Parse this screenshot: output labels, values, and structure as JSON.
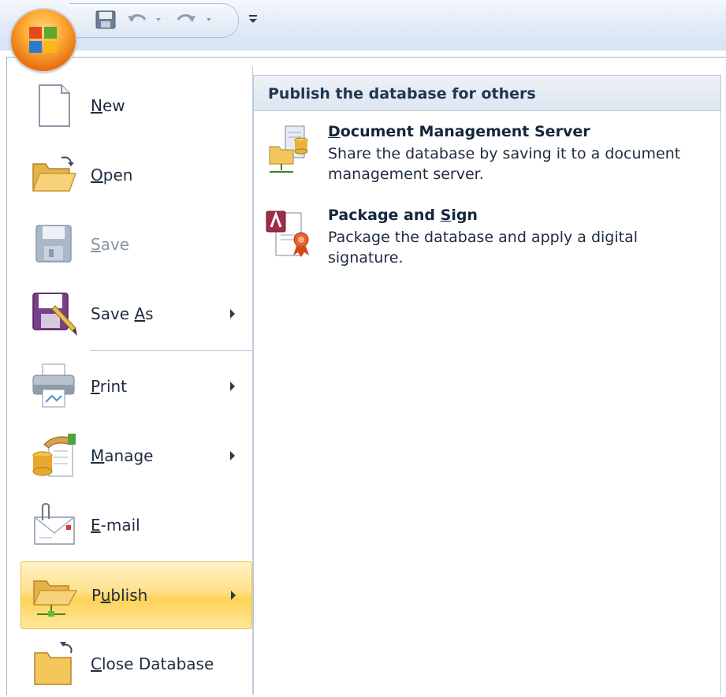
{
  "quick_access": {
    "icons": [
      "save-icon",
      "undo-icon",
      "redo-icon",
      "customize-dropdown-icon"
    ]
  },
  "menu": {
    "items": [
      {
        "label": "New",
        "hotkey_index": 0,
        "icon": "new-document-icon",
        "submenu": false,
        "enabled": true
      },
      {
        "label": "Open",
        "hotkey_index": 0,
        "icon": "open-folder-icon",
        "submenu": false,
        "enabled": true
      },
      {
        "label": "Save",
        "hotkey_index": 0,
        "icon": "save-disk-icon",
        "submenu": false,
        "enabled": false
      },
      {
        "label": "Save As",
        "hotkey_index": 5,
        "icon": "save-as-icon",
        "submenu": true,
        "enabled": true
      },
      {
        "label": "Print",
        "hotkey_index": 0,
        "icon": "printer-icon",
        "submenu": true,
        "enabled": true
      },
      {
        "label": "Manage",
        "hotkey_index": 0,
        "icon": "manage-database-icon",
        "submenu": true,
        "enabled": true
      },
      {
        "label": "E-mail",
        "hotkey_index": 0,
        "icon": "email-icon",
        "submenu": false,
        "enabled": true
      },
      {
        "label": "Publish",
        "hotkey_index": 1,
        "icon": "publish-folder-icon",
        "submenu": true,
        "enabled": true,
        "selected": true
      },
      {
        "label": "Close Database",
        "hotkey_index": 0,
        "icon": "close-folder-icon",
        "submenu": false,
        "enabled": true
      }
    ]
  },
  "submenu": {
    "header": "Publish the database for others",
    "options": [
      {
        "title": "Document Management Server",
        "hotkey_index": 0,
        "description": "Share the database by saving it to a document management server.",
        "icon": "document-server-icon"
      },
      {
        "title": "Package and Sign",
        "hotkey_index": 12,
        "description": "Package the database and apply a digital signature.",
        "icon": "package-sign-icon"
      }
    ]
  },
  "colors": {
    "selected_highlight": "#ffd257",
    "header_text": "#1e3652",
    "disabled_text": "#8a949e"
  }
}
